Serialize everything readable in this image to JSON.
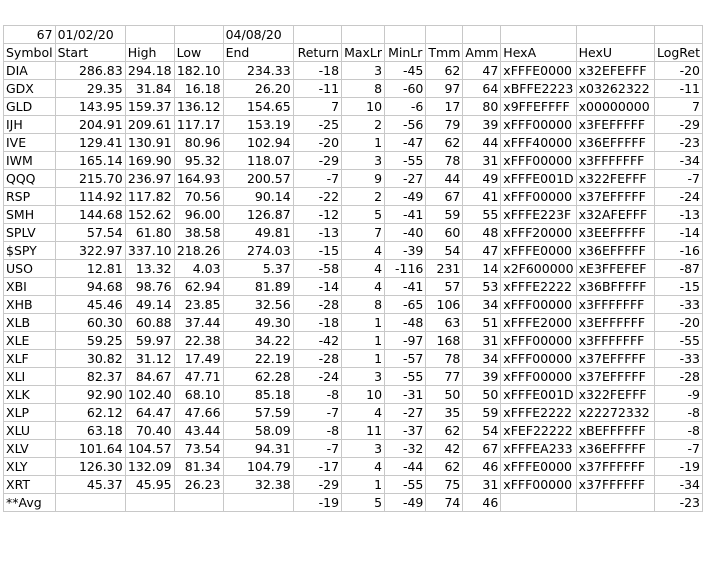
{
  "top": {
    "count": "67",
    "start_date": "01/02/20",
    "end_date": "04/08/20"
  },
  "columns": [
    "Symbol",
    "Start",
    "High",
    "Low",
    "End",
    "Return",
    "MaxLr",
    "MinLr",
    "Tmm",
    "Amm",
    "HexA",
    "HexU",
    "LogRet"
  ],
  "rows": [
    [
      "DIA",
      "286.83",
      "294.18",
      "182.10",
      "234.33",
      "-18",
      "3",
      "-45",
      "62",
      "47",
      "xFFFE0000",
      "x32EFEFFF",
      "-20"
    ],
    [
      "GDX",
      "29.35",
      "31.84",
      "16.18",
      "26.20",
      "-11",
      "8",
      "-60",
      "97",
      "64",
      "xBFFE2223",
      "x03262322",
      "-11"
    ],
    [
      "GLD",
      "143.95",
      "159.37",
      "136.12",
      "154.65",
      "7",
      "10",
      "-6",
      "17",
      "80",
      "x9FFEFFFF",
      "x00000000",
      "7"
    ],
    [
      "IJH",
      "204.91",
      "209.61",
      "117.17",
      "153.19",
      "-25",
      "2",
      "-56",
      "79",
      "39",
      "xFFF00000",
      "x3FEFFFFF",
      "-29"
    ],
    [
      "IVE",
      "129.41",
      "130.91",
      "80.96",
      "102.94",
      "-20",
      "1",
      "-47",
      "62",
      "44",
      "xFFF40000",
      "x36EFFFFF",
      "-23"
    ],
    [
      "IWM",
      "165.14",
      "169.90",
      "95.32",
      "118.07",
      "-29",
      "3",
      "-55",
      "78",
      "31",
      "xFFF00000",
      "x3FFFFFFF",
      "-34"
    ],
    [
      "QQQ",
      "215.70",
      "236.97",
      "164.93",
      "200.57",
      "-7",
      "9",
      "-27",
      "44",
      "49",
      "xFFFE001D",
      "x322FEFFF",
      "-7"
    ],
    [
      "RSP",
      "114.92",
      "117.82",
      "70.56",
      "90.14",
      "-22",
      "2",
      "-49",
      "67",
      "41",
      "xFFF00000",
      "x37EFFFFF",
      "-24"
    ],
    [
      "SMH",
      "144.68",
      "152.62",
      "96.00",
      "126.87",
      "-12",
      "5",
      "-41",
      "59",
      "55",
      "xFFFE223F",
      "x32AFEFFF",
      "-13"
    ],
    [
      "SPLV",
      "57.54",
      "61.80",
      "38.58",
      "49.81",
      "-13",
      "7",
      "-40",
      "60",
      "48",
      "xFFF20000",
      "x3EEFFFFF",
      "-14"
    ],
    [
      "$SPY",
      "322.97",
      "337.10",
      "218.26",
      "274.03",
      "-15",
      "4",
      "-39",
      "54",
      "47",
      "xFFFE0000",
      "x36EFFFFF",
      "-16"
    ],
    [
      "USO",
      "12.81",
      "13.32",
      "4.03",
      "5.37",
      "-58",
      "4",
      "-116",
      "231",
      "14",
      "x2F600000",
      "xE3FFEFEF",
      "-87"
    ],
    [
      "XBI",
      "94.68",
      "98.76",
      "62.94",
      "81.89",
      "-14",
      "4",
      "-41",
      "57",
      "53",
      "xFFFE2222",
      "x36BFFFFF",
      "-15"
    ],
    [
      "XHB",
      "45.46",
      "49.14",
      "23.85",
      "32.56",
      "-28",
      "8",
      "-65",
      "106",
      "34",
      "xFFF00000",
      "x3FFFFFFF",
      "-33"
    ],
    [
      "XLB",
      "60.30",
      "60.88",
      "37.44",
      "49.30",
      "-18",
      "1",
      "-48",
      "63",
      "51",
      "xFFFE2000",
      "x3EFFFFFF",
      "-20"
    ],
    [
      "XLE",
      "59.25",
      "59.97",
      "22.38",
      "34.22",
      "-42",
      "1",
      "-97",
      "168",
      "31",
      "xFFF00000",
      "x3FFFFFFF",
      "-55"
    ],
    [
      "XLF",
      "30.82",
      "31.12",
      "17.49",
      "22.19",
      "-28",
      "1",
      "-57",
      "78",
      "34",
      "xFFF00000",
      "x37EFFFFF",
      "-33"
    ],
    [
      "XLI",
      "82.37",
      "84.67",
      "47.71",
      "62.28",
      "-24",
      "3",
      "-55",
      "77",
      "39",
      "xFFF00000",
      "x37EFFFFF",
      "-28"
    ],
    [
      "XLK",
      "92.90",
      "102.40",
      "68.10",
      "85.18",
      "-8",
      "10",
      "-31",
      "50",
      "50",
      "xFFFE001D",
      "x322FEFFF",
      "-9"
    ],
    [
      "XLP",
      "62.12",
      "64.47",
      "47.66",
      "57.59",
      "-7",
      "4",
      "-27",
      "35",
      "59",
      "xFFFE2222",
      "x22272332",
      "-8"
    ],
    [
      "XLU",
      "63.18",
      "70.40",
      "43.44",
      "58.09",
      "-8",
      "11",
      "-37",
      "62",
      "54",
      "xFEF22222",
      "xBEFFFFFF",
      "-8"
    ],
    [
      "XLV",
      "101.64",
      "104.57",
      "73.54",
      "94.31",
      "-7",
      "3",
      "-32",
      "42",
      "67",
      "xFFFEA233",
      "x36EFFFFF",
      "-7"
    ],
    [
      "XLY",
      "126.30",
      "132.09",
      "81.34",
      "104.79",
      "-17",
      "4",
      "-44",
      "62",
      "46",
      "xFFFE0000",
      "x37FFFFFF",
      "-19"
    ],
    [
      "XRT",
      "45.37",
      "45.95",
      "26.23",
      "32.38",
      "-29",
      "1",
      "-55",
      "75",
      "31",
      "xFFF00000",
      "x37FFFFFF",
      "-34"
    ]
  ],
  "avg_row": [
    "**Avg",
    "",
    "",
    "",
    "",
    "-19",
    "5",
    "-49",
    "74",
    "46",
    "",
    "",
    "-23"
  ]
}
